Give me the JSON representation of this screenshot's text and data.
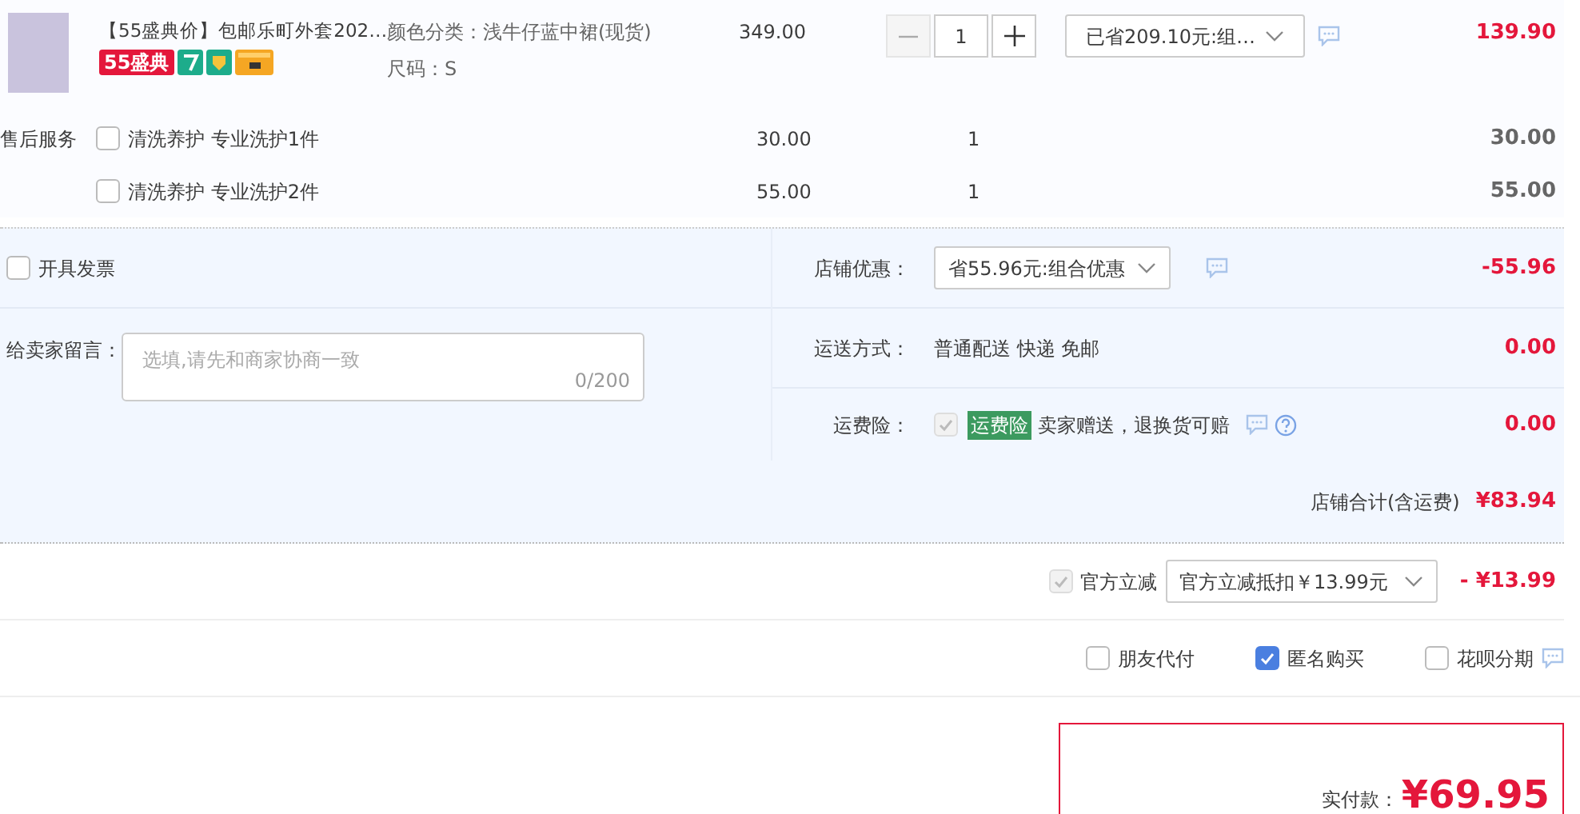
{
  "item": {
    "title": "【55盛典价】包邮乐町外套202…",
    "badges": [
      {
        "kind": "text",
        "label": "55盛典"
      },
      {
        "kind": "seven"
      },
      {
        "kind": "shield"
      },
      {
        "kind": "card"
      }
    ],
    "specs": [
      "颜色分类：浅牛仔蓝中裙(现货)",
      "尺码：S"
    ],
    "price": "349.00",
    "quantity": "1",
    "promo": "已省209.10元:组…",
    "total": "139.90"
  },
  "services": {
    "label": "售后服务",
    "items": [
      {
        "name": "清洗养护 专业洗护1件",
        "checked": false,
        "price": "30.00",
        "quantity": "1",
        "total": "30.00"
      },
      {
        "name": "清洗养护 专业洗护2件",
        "checked": false,
        "price": "55.00",
        "quantity": "1",
        "total": "55.00"
      }
    ]
  },
  "invoice": {
    "label": "开具发票",
    "checked": false
  },
  "message": {
    "label": "给卖家留言：",
    "placeholder": "选填,请先和商家协商一致",
    "count": "0/200"
  },
  "shop_rows": [
    {
      "kind": "select",
      "label": "店铺优惠：",
      "value": "省55.96元:组合优惠",
      "amount": "-55.96"
    },
    {
      "kind": "text",
      "label": "运送方式：",
      "value": "普通配送 快递 免邮",
      "amount": "0.00"
    },
    {
      "kind": "insurance",
      "label": "运费险：",
      "checked": true,
      "tag": "运费险",
      "value": "卖家赠送，退换货可赔",
      "amount": "0.00"
    }
  ],
  "shop_total": {
    "label": "店铺合计(含运费)",
    "amount": "¥83.94"
  },
  "official": {
    "label": "官方立减",
    "checked": true,
    "value": "官方立减抵扣￥13.99元",
    "amount_sign": "-",
    "amount": "¥13.99"
  },
  "options": [
    {
      "label": "朋友代付",
      "checked": false
    },
    {
      "label": "匿名购买",
      "checked": true
    },
    {
      "label": "花呗分期",
      "checked": false
    }
  ],
  "payment": {
    "label": "实付款：",
    "amount": "¥69.95"
  }
}
